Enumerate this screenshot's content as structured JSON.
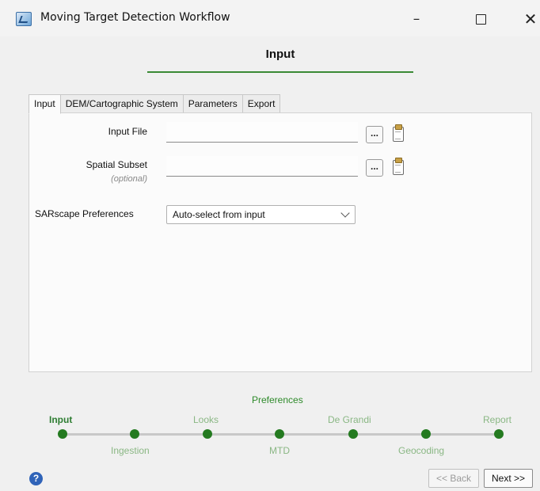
{
  "window": {
    "title": "Moving Target Detection Workflow",
    "minimize_glyph": "–",
    "close_glyph": "✕"
  },
  "step_title": "Input",
  "tabs": [
    {
      "label": "Input",
      "active": true
    },
    {
      "label": "DEM/Cartographic System",
      "active": false
    },
    {
      "label": "Parameters",
      "active": false
    },
    {
      "label": "Export",
      "active": false
    }
  ],
  "form": {
    "input_file": {
      "label": "Input File",
      "value": "",
      "browse_label": "..."
    },
    "spatial_subset": {
      "label": "Spatial Subset",
      "sublabel": "(optional)",
      "value": "",
      "browse_label": "..."
    },
    "preferences": {
      "label": "SARscape Preferences",
      "selected": "Auto-select from input"
    }
  },
  "workflow": {
    "preferences_label": "Preferences",
    "steps": [
      "Input",
      "Ingestion",
      "Looks",
      "MTD",
      "De Grandi",
      "Geocoding",
      "Report"
    ],
    "current": "Input"
  },
  "footer": {
    "help_glyph": "?",
    "back_label": "<< Back",
    "next_label": "Next >>"
  },
  "colors": {
    "accent_green": "#247a20",
    "header_underline": "#3b8a35",
    "help_blue": "#2f63b8"
  }
}
